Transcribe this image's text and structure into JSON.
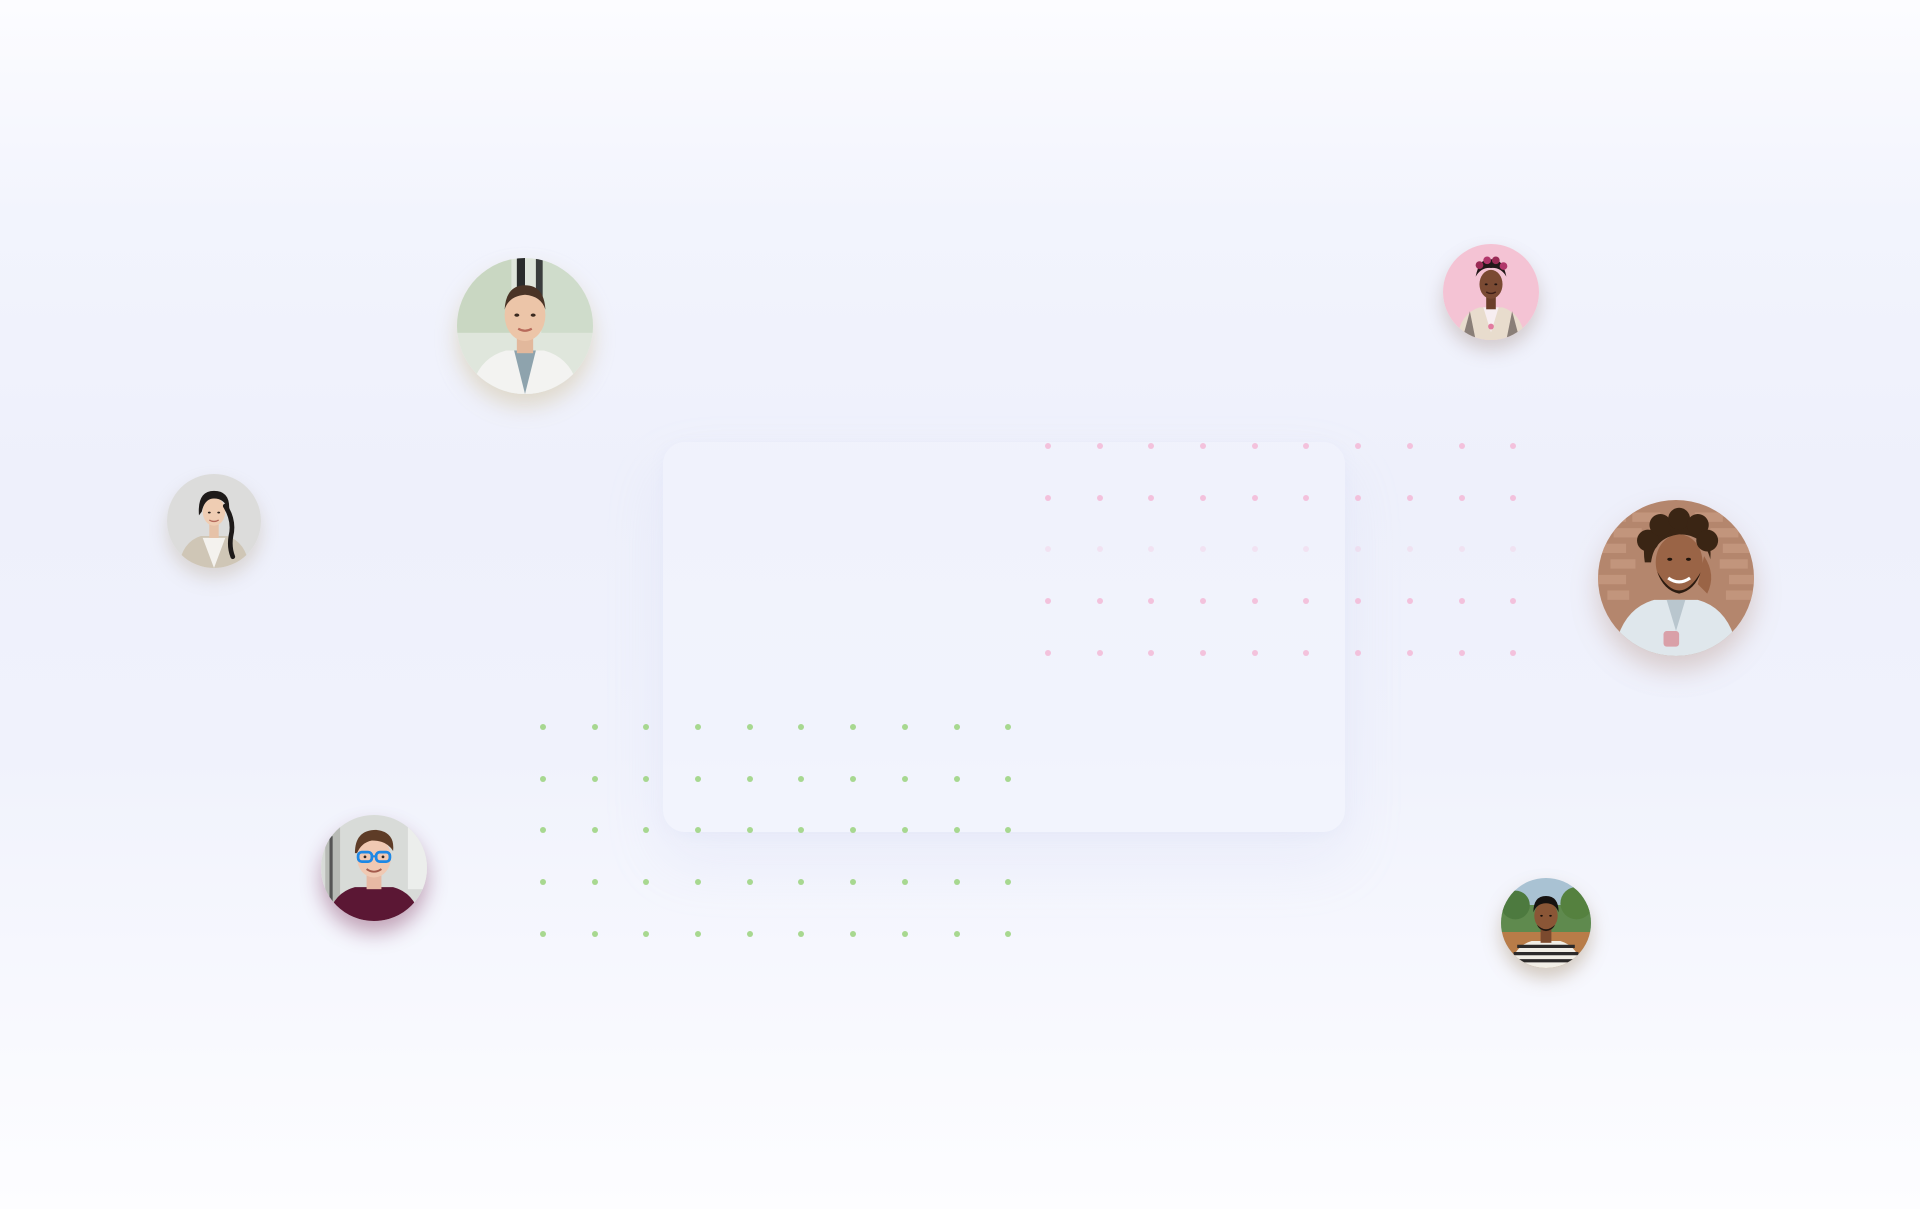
{
  "dot_grids": {
    "pink": {
      "color": "#f3b9d6",
      "columns": 10,
      "rows": 5,
      "empty_rows": [
        2
      ]
    },
    "green": {
      "color": "#9ad27c",
      "columns": 10,
      "rows": 5,
      "empty_rows": []
    }
  },
  "avatars": [
    {
      "id": "woman-white-coat",
      "icon": "avatar-photo"
    },
    {
      "id": "woman-pink-background",
      "icon": "avatar-photo"
    },
    {
      "id": "woman-braid",
      "icon": "avatar-photo"
    },
    {
      "id": "man-curly-hair-laughing",
      "icon": "avatar-photo"
    },
    {
      "id": "man-blue-glasses",
      "icon": "avatar-photo"
    },
    {
      "id": "man-striped-shirt",
      "icon": "avatar-photo"
    }
  ],
  "colors": {
    "background": "#eef0fb",
    "pink_accent": "#f3b9d6",
    "green_accent": "#9ad27c"
  }
}
